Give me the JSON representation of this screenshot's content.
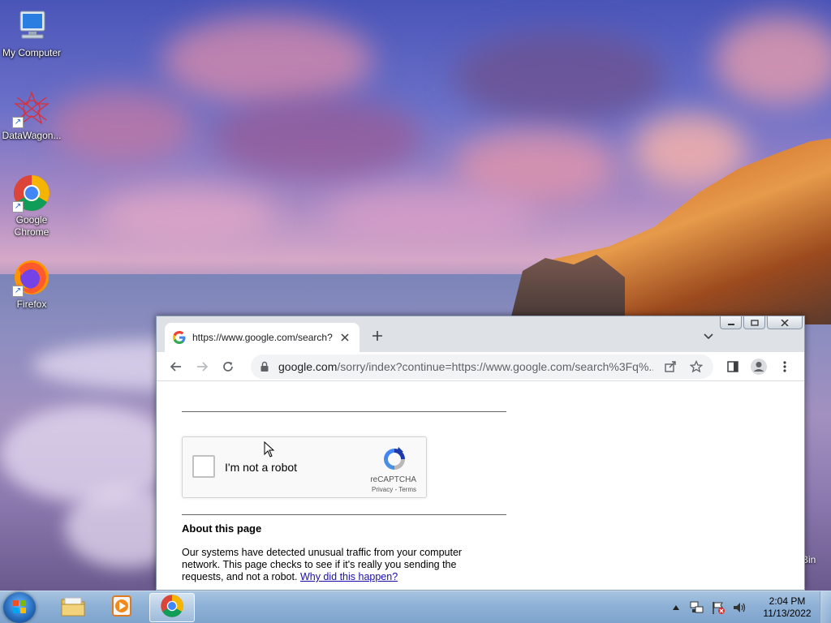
{
  "desktop": {
    "icons": [
      {
        "label": "My Computer",
        "icon": "computer-icon"
      },
      {
        "label": "DataWagon...",
        "icon": "datawagon-icon"
      },
      {
        "label": "Google Chrome",
        "icon": "chrome-icon"
      },
      {
        "label": "Firefox",
        "icon": "firefox-icon"
      }
    ],
    "recycle_bin_label": "Bin"
  },
  "browser": {
    "tab": {
      "title": "https://www.google.com/search?",
      "icon": "google-favicon"
    },
    "address_bar": {
      "host": "google.com",
      "path": "/sorry/index?continue=https://www.google.com/search%3Fq%..."
    },
    "page": {
      "recaptcha": {
        "label": "I'm not a robot",
        "brand": "reCAPTCHA",
        "privacy": "Privacy",
        "separator": " - ",
        "terms": "Terms"
      },
      "about_title": "About this page",
      "about_text": "Our systems have detected unusual traffic from your computer network. This page checks to see if it's really you sending the requests, and not a robot.",
      "about_link": "Why did this happen?"
    }
  },
  "taskbar": {
    "clock_time": "2:04 PM",
    "clock_date": "11/13/2022"
  },
  "colors": {
    "chrome_toolbar": "#ffffff",
    "chrome_tabstrip": "#dee1e6",
    "link": "#1a0dab",
    "taskbar": "#8eb1d6"
  }
}
